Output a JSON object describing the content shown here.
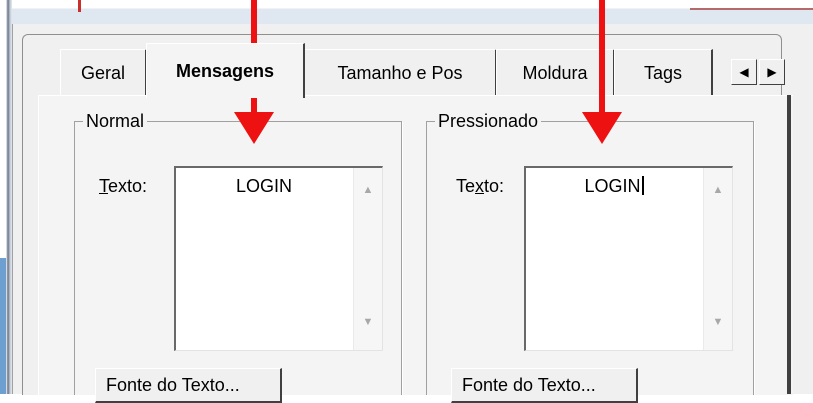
{
  "tabs": [
    {
      "label": "Geral"
    },
    {
      "label": "Mensagens",
      "active": true
    },
    {
      "label": "Tamanho e Pos"
    },
    {
      "label": "Moldura"
    },
    {
      "label": "Tags"
    }
  ],
  "tab_scroll": {
    "left_icon": "triangle-left-icon",
    "right_icon": "triangle-right-icon"
  },
  "groups": {
    "normal": {
      "title": "Normal",
      "text_label_accel": "T",
      "text_label_rest": "exto:",
      "text_value": "LOGIN",
      "font_button": "Fonte do Texto..."
    },
    "pressed": {
      "title": "Pressionado",
      "text_label_pre": "Te",
      "text_label_accel": "x",
      "text_label_rest": "to:",
      "text_value": "LOGIN",
      "font_button": "Fonte do Texto..."
    }
  },
  "annotations": {
    "arrow_color": "#ee1111"
  }
}
